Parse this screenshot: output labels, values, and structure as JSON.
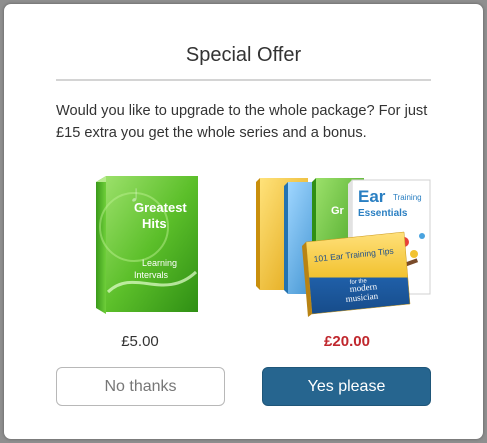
{
  "dialog": {
    "title": "Special Offer",
    "message": "Would you like to upgrade to the whole package? For just £15 extra you get the whole series and a bonus."
  },
  "single_product": {
    "title_line1": "Greatest",
    "title_line2": "Hits",
    "subtitle_line1": "Learning",
    "subtitle_line2": "Intervals",
    "price": "£5.00"
  },
  "bundle_product": {
    "back_box_title1": "Ear",
    "back_box_title1b": "Training",
    "back_box_title2": "Essentials",
    "peek_label": "Gr",
    "front_book_title": "101 Ear Training Tips",
    "front_book_sub1": "for the",
    "front_book_sub2": "modern",
    "front_book_sub3": "musician",
    "price": "£20.00"
  },
  "buttons": {
    "decline_label": "No thanks",
    "accept_label": "Yes please"
  },
  "colors": {
    "accent_button": "#26658f",
    "bundle_price": "#c0272d",
    "green_box": "#5cbf2a",
    "yellow_box": "#f2c230",
    "blue_box": "#4aa3df"
  }
}
